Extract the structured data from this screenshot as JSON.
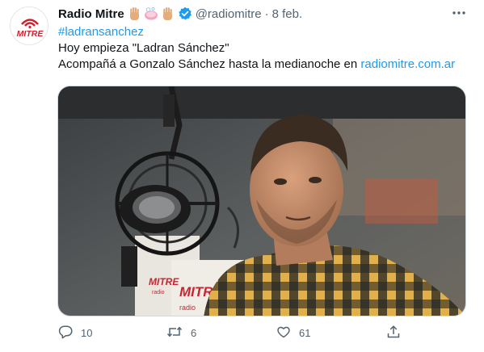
{
  "tweet": {
    "author_name": "Radio Mitre",
    "emojis": [
      "raised-hand-icon",
      "soap-icon",
      "raised-hand-icon"
    ],
    "handle": "@radiomitre",
    "separator": "·",
    "date": "8 feb.",
    "hashtag": "#ladransanchez",
    "line1": "Hoy empieza \"Ladran Sánchez\"",
    "line2_prefix": "Acompañá a Gonzalo Sánchez hasta la medianoche en ",
    "line2_link": "radiomitre.com.ar",
    "avatar_text": "MITRE"
  },
  "media": {
    "image_text": [
      "MITRE",
      "radio",
      "MITRE",
      "radio"
    ],
    "image_subject": "man-with-microphone-photo"
  },
  "actions": {
    "reply_count": "10",
    "retweet_count": "6",
    "like_count": "61"
  },
  "colors": {
    "link": "#1d9bf0",
    "text": "#0f1419",
    "muted": "#536471",
    "brand_red": "#d0202e",
    "verified": "#1d9bf0"
  }
}
